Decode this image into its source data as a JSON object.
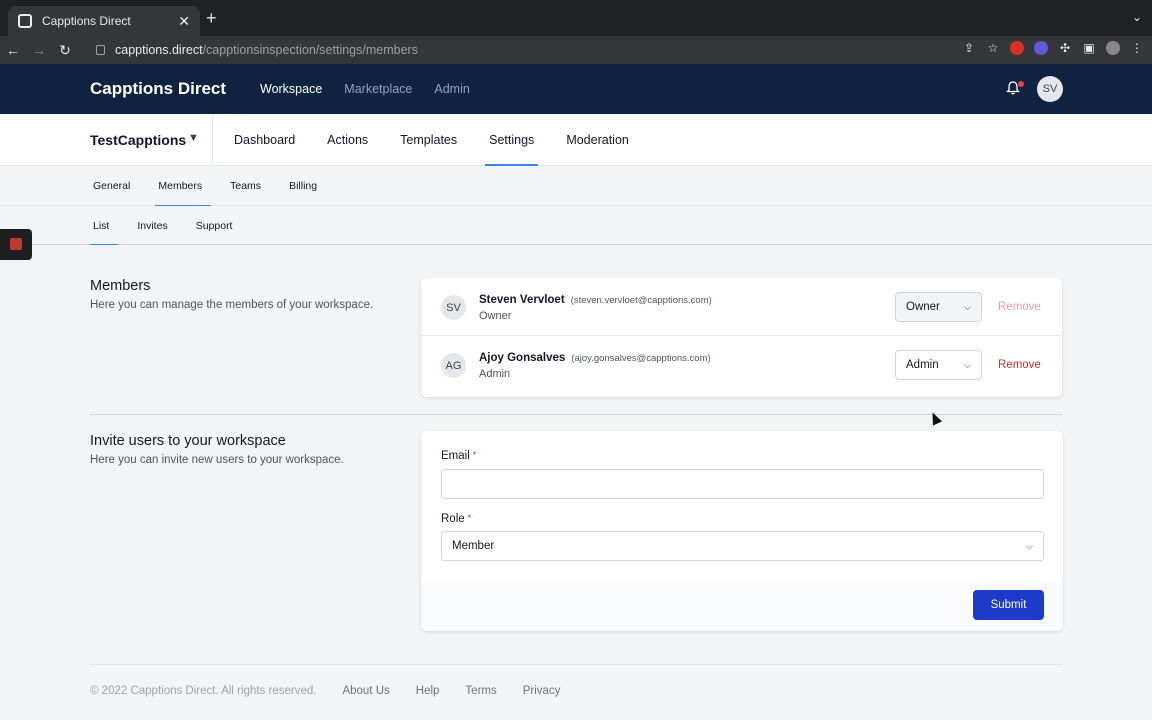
{
  "browser": {
    "tab_title": "Capptions Direct",
    "url_host": "capptions.direct",
    "url_path": "/capptionsinspection/settings/members"
  },
  "header": {
    "brand": "Capptions Direct",
    "nav": [
      {
        "label": "Workspace",
        "active": true
      },
      {
        "label": "Marketplace",
        "active": false
      },
      {
        "label": "Admin",
        "active": false
      }
    ],
    "user_initials": "SV"
  },
  "workspace_bar": {
    "workspace_name": "TestCapptions",
    "tabs": [
      "Dashboard",
      "Actions",
      "Templates",
      "Settings",
      "Moderation"
    ],
    "active_tab": "Settings"
  },
  "settings_tabs": {
    "items": [
      "General",
      "Members",
      "Teams",
      "Billing"
    ],
    "active": "Members"
  },
  "members_tabs": {
    "items": [
      "List",
      "Invites",
      "Support"
    ],
    "active": "List"
  },
  "members_section": {
    "title": "Members",
    "description": "Here you can manage the members of your workspace.",
    "members": [
      {
        "initials": "SV",
        "name": "Steven Vervloet",
        "email": "(steven.vervloet@capptions.com)",
        "role_label": "Owner",
        "role_select": "Owner",
        "remove_label": "Remove",
        "disabled": true
      },
      {
        "initials": "AG",
        "name": "Ajoy Gonsalves",
        "email": "(ajoy.gonsalves@capptions.com)",
        "role_label": "Admin",
        "role_select": "Admin",
        "remove_label": "Remove",
        "disabled": false
      }
    ]
  },
  "invite_section": {
    "title": "Invite users to your workspace",
    "description": "Here you can invite new users to your workspace.",
    "email_label": "Email",
    "email_value": "",
    "role_label": "Role",
    "role_value": "Member",
    "required_mark": "*",
    "submit_label": "Submit"
  },
  "footer": {
    "copyright": "© 2022 Capptions Direct. All rights reserved.",
    "links": [
      "About Us",
      "Help",
      "Terms",
      "Privacy"
    ]
  }
}
